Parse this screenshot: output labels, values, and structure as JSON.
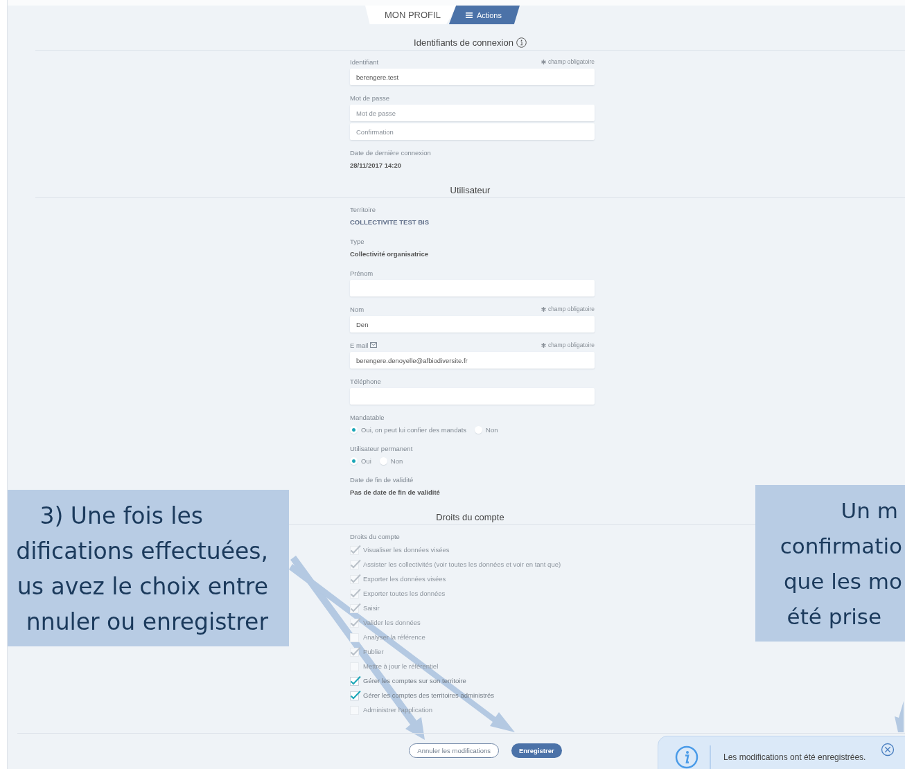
{
  "profile_tab": {
    "label": "MON PROFIL"
  },
  "actions_button": {
    "label": "Actions"
  },
  "sections": [
    {
      "title": "Identifiants de connexion",
      "info": true,
      "fields": [
        {
          "kind": "input",
          "label": "Identifiant",
          "required_note": "champ obligatoire",
          "value": "berengere.test"
        },
        {
          "kind": "input",
          "label": "Mot de passe",
          "placeholder": "Mot de passe"
        },
        {
          "kind": "input",
          "placeholder": "Confirmation"
        },
        {
          "kind": "text",
          "label": "Date de dernière connexion",
          "value": "28/11/2017 14:20"
        }
      ]
    },
    {
      "title": "Utilisateur",
      "fields": [
        {
          "kind": "text",
          "label": "Territoire",
          "value": "COLLECTIVITE TEST BIS",
          "accent": true
        },
        {
          "kind": "text",
          "label": "Type",
          "value": "Collectivité organisatrice"
        },
        {
          "kind": "input",
          "label": "Prénom"
        },
        {
          "kind": "input",
          "label": "Nom",
          "required_note": "champ obligatoire",
          "value": "Den"
        },
        {
          "kind": "email",
          "label": "E mail",
          "required_note": "champ obligatoire",
          "value": "berengere.denoyelle@afbiodiversite.fr"
        },
        {
          "kind": "input",
          "label": "Téléphone"
        },
        {
          "kind": "radio",
          "label": "Mandatable",
          "options": [
            {
              "label": "Oui, on peut lui confier des mandats",
              "selected": true
            },
            {
              "label": "Non",
              "selected": false
            }
          ]
        },
        {
          "kind": "radio",
          "label": "Utilisateur permanent",
          "options": [
            {
              "label": "Oui",
              "selected": true
            },
            {
              "label": "Non",
              "selected": false
            }
          ]
        },
        {
          "kind": "text",
          "label": "Date de fin de validité",
          "value": "Pas de date de fin de validité"
        }
      ]
    },
    {
      "title": "Droits du compte",
      "fields": [
        {
          "kind": "checklist",
          "label": "Droits du compte",
          "items": [
            {
              "label": "Visualiser les données visées",
              "checked": true,
              "disabled": true
            },
            {
              "label": "Assister les collectivités (voir toutes les données et voir en tant que)",
              "checked": true,
              "disabled": true
            },
            {
              "label": "Exporter les données visées",
              "checked": true,
              "disabled": true
            },
            {
              "label": "Exporter toutes les données",
              "checked": true,
              "disabled": true
            },
            {
              "label": "Saisir",
              "checked": true,
              "disabled": true
            },
            {
              "label": "Valider les données",
              "checked": true,
              "disabled": true
            },
            {
              "label": "Analyser la référence",
              "checked": false,
              "disabled": true
            },
            {
              "label": "Publier",
              "checked": true,
              "disabled": true
            },
            {
              "label": "Mettre à jour le référentiel",
              "checked": false,
              "disabled": true
            },
            {
              "label": "Gérer les comptes sur son territoire",
              "checked": true,
              "disabled": false
            },
            {
              "label": "Gérer les comptes des territoires administrés",
              "checked": true,
              "disabled": false
            },
            {
              "label": "Administrer l'application",
              "checked": false,
              "disabled": true
            }
          ]
        }
      ]
    }
  ],
  "buttons": [
    {
      "kind": "cancel",
      "label": "Annuler les modifications"
    },
    {
      "kind": "save",
      "label": "Enregistrer"
    }
  ],
  "toast": {
    "message": "Les modifications ont été enregistrées."
  },
  "callouts": [
    {
      "kind": "left",
      "lines": [
        "3) Une fois les",
        "difications effectuées,",
        "us avez le choix entre",
        "nnuler ou enregistrer"
      ]
    },
    {
      "kind": "right",
      "lines": [
        "Un m",
        "confirmatio",
        "que les mo",
        "été prise"
      ]
    }
  ]
}
